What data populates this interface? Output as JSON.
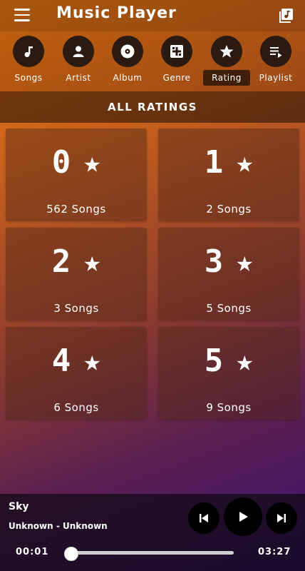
{
  "app": {
    "title": "Music Player"
  },
  "tabs": [
    {
      "label": "Songs",
      "icon": "music-note-icon"
    },
    {
      "label": "Artist",
      "icon": "person-icon"
    },
    {
      "label": "Album",
      "icon": "disc-icon"
    },
    {
      "label": "Genre",
      "icon": "genre-icon"
    },
    {
      "label": "Rating",
      "icon": "star-icon",
      "active": true
    },
    {
      "label": "Playlist",
      "icon": "playlist-icon"
    }
  ],
  "section": {
    "title": "ALL RATINGS"
  },
  "ratings": [
    {
      "value": "0",
      "count": "562 Songs"
    },
    {
      "value": "1",
      "count": "2 Songs"
    },
    {
      "value": "2",
      "count": "3 Songs"
    },
    {
      "value": "3",
      "count": "5 Songs"
    },
    {
      "value": "4",
      "count": "6 Songs"
    },
    {
      "value": "5",
      "count": "9 Songs"
    }
  ],
  "player": {
    "title": "Sky",
    "artist": "Unknown - Unknown",
    "elapsed": "00:01",
    "duration": "03:27",
    "progress": 0.005
  },
  "colors": {
    "accent": "#f07a10",
    "dark": "#2a1a12"
  }
}
